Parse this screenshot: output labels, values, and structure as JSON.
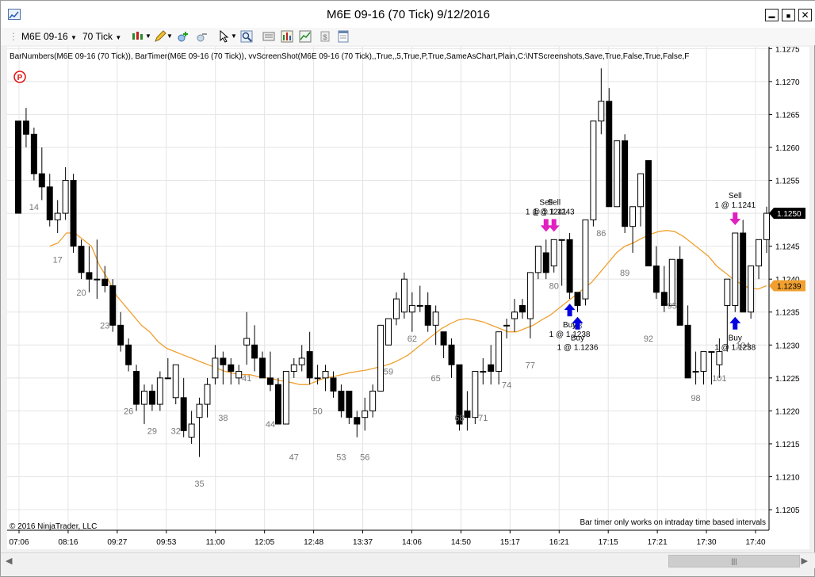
{
  "window": {
    "title": "M6E 09-16 (70 Tick)  9/12/2016",
    "minimize": "▬",
    "maximize": "■",
    "close": "✕"
  },
  "toolbar": {
    "instrument": "M6E 09-16",
    "interval": "70 Tick"
  },
  "chart": {
    "indicator_line": "BarNumbers(M6E 09-16 (70 Tick)), BarTimer(M6E 09-16 (70 Tick)), vvScreenShot(M6E 09-16 (70 Tick),,True,,5,True,P,True,SameAsChart,Plain,C:\\NTScreenshots,Save,True,False,True,False,F",
    "copyright": "© 2016 NinjaTrader, LLC",
    "bar_timer_msg": "Bar timer only works on intraday time based intervals",
    "p_marker": "P",
    "last_price": "1.1250",
    "ma_price": "1.1239",
    "colors": {
      "ma_line": "#f0a030",
      "up_body": "#ffffff",
      "down_body": "#000000",
      "sell_arrow": "#e020c0",
      "buy_arrow": "#0000e0",
      "last_label": "#000000",
      "ma_label": "#f0a030"
    }
  },
  "chart_data": {
    "type": "candlestick",
    "ylim": [
      1.1202,
      1.1277
    ],
    "y_ticks": [
      "1.1275",
      "1.1270",
      "1.1265",
      "1.1260",
      "1.1255",
      "1.1250",
      "1.1245",
      "1.1240",
      "1.1235",
      "1.1230",
      "1.1225",
      "1.1220",
      "1.1215",
      "1.1210",
      "1.1205"
    ],
    "x_ticks": [
      "07:06",
      "08:16",
      "09:27",
      "09:53",
      "11:00",
      "12:05",
      "12:48",
      "13:37",
      "14:06",
      "14:50",
      "15:17",
      "16:21",
      "17:15",
      "17:21",
      "17:30",
      "17:40"
    ],
    "bar_numbers": [
      {
        "label": "14",
        "idx": 2,
        "y": 1.12505
      },
      {
        "label": "17",
        "idx": 5,
        "y": 1.12425
      },
      {
        "label": "20",
        "idx": 8,
        "y": 1.12375
      },
      {
        "label": "23",
        "idx": 11,
        "y": 1.12325
      },
      {
        "label": "26",
        "idx": 14,
        "y": 1.12195
      },
      {
        "label": "29",
        "idx": 17,
        "y": 1.12165
      },
      {
        "label": "32",
        "idx": 20,
        "y": 1.12165
      },
      {
        "label": "35",
        "idx": 23,
        "y": 1.12085
      },
      {
        "label": "38",
        "idx": 26,
        "y": 1.12185
      },
      {
        "label": "41",
        "idx": 29,
        "y": 1.12245
      },
      {
        "label": "44",
        "idx": 32,
        "y": 1.12175
      },
      {
        "label": "47",
        "idx": 35,
        "y": 1.12125
      },
      {
        "label": "50",
        "idx": 38,
        "y": 1.12195
      },
      {
        "label": "53",
        "idx": 41,
        "y": 1.12125
      },
      {
        "label": "56",
        "idx": 44,
        "y": 1.12125
      },
      {
        "label": "59",
        "idx": 47,
        "y": 1.12255
      },
      {
        "label": "62",
        "idx": 50,
        "y": 1.12305
      },
      {
        "label": "65",
        "idx": 53,
        "y": 1.12245
      },
      {
        "label": "68",
        "idx": 56,
        "y": 1.12185
      },
      {
        "label": "71",
        "idx": 59,
        "y": 1.12185
      },
      {
        "label": "74",
        "idx": 62,
        "y": 1.12235
      },
      {
        "label": "77",
        "idx": 65,
        "y": 1.12265
      },
      {
        "label": "80",
        "idx": 68,
        "y": 1.12385
      },
      {
        "label": "83",
        "idx": 71,
        "y": 1.12325
      },
      {
        "label": "86",
        "idx": 74,
        "y": 1.12465
      },
      {
        "label": "89",
        "idx": 77,
        "y": 1.12405
      },
      {
        "label": "92",
        "idx": 80,
        "y": 1.12305
      },
      {
        "label": "95",
        "idx": 83,
        "y": 1.12355
      },
      {
        "label": "98",
        "idx": 86,
        "y": 1.12215
      },
      {
        "label": "101",
        "idx": 89,
        "y": 1.12245
      },
      {
        "label": "104",
        "idx": 92,
        "y": 1.12295
      }
    ],
    "candles": [
      [
        1.1264,
        1.1264,
        1.125,
        1.125
      ],
      [
        1.1264,
        1.1266,
        1.126,
        1.1262
      ],
      [
        1.1262,
        1.1263,
        1.1255,
        1.1256
      ],
      [
        1.1256,
        1.126,
        1.1252,
        1.1254
      ],
      [
        1.1254,
        1.1256,
        1.1248,
        1.1249
      ],
      [
        1.1249,
        1.1252,
        1.1247,
        1.125
      ],
      [
        1.125,
        1.1257,
        1.1249,
        1.1255
      ],
      [
        1.1255,
        1.1256,
        1.1244,
        1.1245
      ],
      [
        1.1245,
        1.1246,
        1.124,
        1.1241
      ],
      [
        1.1241,
        1.1245,
        1.1238,
        1.124
      ],
      [
        1.124,
        1.1246,
        1.1237,
        1.124
      ],
      [
        1.124,
        1.1242,
        1.1238,
        1.1239
      ],
      [
        1.1239,
        1.124,
        1.1232,
        1.1233
      ],
      [
        1.1233,
        1.1235,
        1.1229,
        1.123
      ],
      [
        1.123,
        1.1231,
        1.1226,
        1.1227
      ],
      [
        1.1226,
        1.1227,
        1.122,
        1.1221
      ],
      [
        1.1221,
        1.1224,
        1.1218,
        1.1223
      ],
      [
        1.1223,
        1.1224,
        1.122,
        1.1221
      ],
      [
        1.1221,
        1.1226,
        1.122,
        1.1225
      ],
      [
        1.1225,
        1.1228,
        1.1225,
        1.1225
      ],
      [
        1.1222,
        1.1227,
        1.1221,
        1.1227
      ],
      [
        1.1222,
        1.1225,
        1.1216,
        1.1217
      ],
      [
        1.1216,
        1.122,
        1.1215,
        1.1218
      ],
      [
        1.1219,
        1.1222,
        1.1213,
        1.1221
      ],
      [
        1.1221,
        1.1225,
        1.1219,
        1.1224
      ],
      [
        1.1225,
        1.123,
        1.1224,
        1.1228
      ],
      [
        1.1228,
        1.1229,
        1.1224,
        1.1227
      ],
      [
        1.1227,
        1.1228,
        1.1224,
        1.1226
      ],
      [
        1.1225,
        1.1227,
        1.1224,
        1.1226
      ],
      [
        1.123,
        1.1235,
        1.1227,
        1.1231
      ],
      [
        1.123,
        1.1233,
        1.1226,
        1.1228
      ],
      [
        1.1228,
        1.1229,
        1.1225,
        1.1225
      ],
      [
        1.1225,
        1.1229,
        1.1223,
        1.1224
      ],
      [
        1.1224,
        1.1225,
        1.1218,
        1.1218
      ],
      [
        1.1218,
        1.1226,
        1.1218,
        1.1226
      ],
      [
        1.1226,
        1.1228,
        1.1225,
        1.1227
      ],
      [
        1.1227,
        1.123,
        1.1226,
        1.1228
      ],
      [
        1.1229,
        1.1232,
        1.1224,
        1.1225
      ],
      [
        1.1225,
        1.1227,
        1.1224,
        1.1225
      ],
      [
        1.1225,
        1.1227,
        1.1223,
        1.1226
      ],
      [
        1.1225,
        1.1226,
        1.1222,
        1.1223
      ],
      [
        1.1223,
        1.1224,
        1.1219,
        1.122
      ],
      [
        1.1223,
        1.1223,
        1.1218,
        1.1219
      ],
      [
        1.1219,
        1.122,
        1.1216,
        1.1218
      ],
      [
        1.1219,
        1.1222,
        1.1217,
        1.122
      ],
      [
        1.122,
        1.1224,
        1.1219,
        1.1223
      ],
      [
        1.1223,
        1.1233,
        1.1223,
        1.1233
      ],
      [
        1.123,
        1.1234,
        1.123,
        1.1234
      ],
      [
        1.1234,
        1.1238,
        1.1233,
        1.1237
      ],
      [
        1.1235,
        1.1241,
        1.1234,
        1.124
      ],
      [
        1.1235,
        1.1238,
        1.1232,
        1.1236
      ],
      [
        1.1236,
        1.1239,
        1.1235,
        1.1236
      ],
      [
        1.1236,
        1.1238,
        1.1232,
        1.1233
      ],
      [
        1.1233,
        1.1236,
        1.123,
        1.1235
      ],
      [
        1.1232,
        1.1232,
        1.1228,
        1.123
      ],
      [
        1.123,
        1.1231,
        1.1225,
        1.1227
      ],
      [
        1.1227,
        1.1227,
        1.1217,
        1.1218
      ],
      [
        1.122,
        1.1223,
        1.1217,
        1.1219
      ],
      [
        1.1219,
        1.1226,
        1.1218,
        1.1226
      ],
      [
        1.1226,
        1.1228,
        1.1224,
        1.1226
      ],
      [
        1.1227,
        1.123,
        1.1224,
        1.1226
      ],
      [
        1.1226,
        1.1232,
        1.1224,
        1.1232
      ],
      [
        1.1233,
        1.1234,
        1.1231,
        1.1233
      ],
      [
        1.1234,
        1.1237,
        1.1232,
        1.1235
      ],
      [
        1.1236,
        1.1237,
        1.1234,
        1.1235
      ],
      [
        1.1234,
        1.1241,
        1.1231,
        1.1241
      ],
      [
        1.1241,
        1.1245,
        1.124,
        1.1245
      ],
      [
        1.1244,
        1.1246,
        1.124,
        1.1241
      ],
      [
        1.1242,
        1.1246,
        1.1241,
        1.1246
      ],
      [
        1.1246,
        1.1246,
        1.1239,
        1.1246
      ],
      [
        1.1246,
        1.1247,
        1.1237,
        1.1238
      ],
      [
        1.1238,
        1.1238,
        1.1235,
        1.1236
      ],
      [
        1.1237,
        1.1249,
        1.1236,
        1.1249
      ],
      [
        1.1249,
        1.1264,
        1.1248,
        1.1264
      ],
      [
        1.1264,
        1.1272,
        1.1262,
        1.1267
      ],
      [
        1.1267,
        1.1269,
        1.1251,
        1.1251
      ],
      [
        1.1251,
        1.1261,
        1.1251,
        1.1261
      ],
      [
        1.1261,
        1.1262,
        1.1247,
        1.1248
      ],
      [
        1.1248,
        1.125,
        1.1244,
        1.1251
      ],
      [
        1.1251,
        1.1256,
        1.1248,
        1.1256
      ],
      [
        1.1258,
        1.1258,
        1.1242,
        1.1242
      ],
      [
        1.1242,
        1.1245,
        1.1237,
        1.1238
      ],
      [
        1.1238,
        1.1242,
        1.1235,
        1.1236
      ],
      [
        1.1236,
        1.124,
        1.1236,
        1.1243
      ],
      [
        1.1243,
        1.1245,
        1.1233,
        1.1233
      ],
      [
        1.1233,
        1.1236,
        1.1229,
        1.1225
      ],
      [
        1.1226,
        1.1229,
        1.1224,
        1.1226
      ],
      [
        1.1226,
        1.1229,
        1.1224,
        1.1229
      ],
      [
        1.1229,
        1.1229,
        1.1224,
        1.1229
      ],
      [
        1.1227,
        1.1231,
        1.1225,
        1.1229
      ],
      [
        1.1236,
        1.124,
        1.1229,
        1.124
      ],
      [
        1.1236,
        1.1247,
        1.1235,
        1.1247
      ],
      [
        1.1247,
        1.1249,
        1.1235,
        1.1235
      ],
      [
        1.1235,
        1.1242,
        1.1234,
        1.1242
      ],
      [
        1.1242,
        1.1246,
        1.124,
        1.1246
      ],
      [
        1.1246,
        1.1251,
        1.1244,
        1.125
      ]
    ],
    "ma": [
      1.1245,
      1.12455,
      1.1247,
      1.1247,
      1.1246,
      1.1245,
      1.1242,
      1.124,
      1.12375,
      1.1236,
      1.12345,
      1.1233,
      1.1232,
      1.12305,
      1.12295,
      1.1229,
      1.12285,
      1.1228,
      1.12275,
      1.1227,
      1.12265,
      1.1226,
      1.12257,
      1.12255,
      1.12255,
      1.12252,
      1.1225,
      1.12248,
      1.12245,
      1.12243,
      1.1224,
      1.1224,
      1.12245,
      1.1225,
      1.12252,
      1.12255,
      1.12258,
      1.1226,
      1.12262,
      1.12265,
      1.12268,
      1.12272,
      1.12278,
      1.12285,
      1.12295,
      1.12305,
      1.12315,
      1.12325,
      1.12332,
      1.12338,
      1.1234,
      1.12338,
      1.12335,
      1.1233,
      1.12325,
      1.1232,
      1.1232,
      1.12325,
      1.1233,
      1.12338,
      1.12345,
      1.12355,
      1.12365,
      1.12375,
      1.12385,
      1.12395,
      1.1241,
      1.12425,
      1.1244,
      1.1245,
      1.12455,
      1.12462,
      1.12468,
      1.12472,
      1.12474,
      1.12472,
      1.12465,
      1.12455,
      1.12445,
      1.12435,
      1.1242,
      1.1241,
      1.124,
      1.12392,
      1.12386,
      1.12385,
      1.1239
    ],
    "ma_start_idx": 4,
    "ma_x_start": 0.05,
    "orders": [
      {
        "type": "sell",
        "idx": 67,
        "text1": "Sell",
        "text2": "1 @ 1.1241"
      },
      {
        "type": "sell",
        "idx": 68,
        "text1": "Sell",
        "text2": "1 @ 1.1243"
      },
      {
        "type": "buy",
        "idx": 70,
        "text1": "Buy",
        "text2": "1 @ 1.1238"
      },
      {
        "type": "buy",
        "idx": 71,
        "text1": "Buy",
        "text2": "1 @ 1.1236"
      },
      {
        "type": "sell",
        "idx": 91,
        "text1": "Sell",
        "text2": "1 @ 1.1241"
      },
      {
        "type": "buy",
        "idx": 91,
        "text1": "Buy",
        "text2": "1 @ 1.1238"
      }
    ]
  }
}
